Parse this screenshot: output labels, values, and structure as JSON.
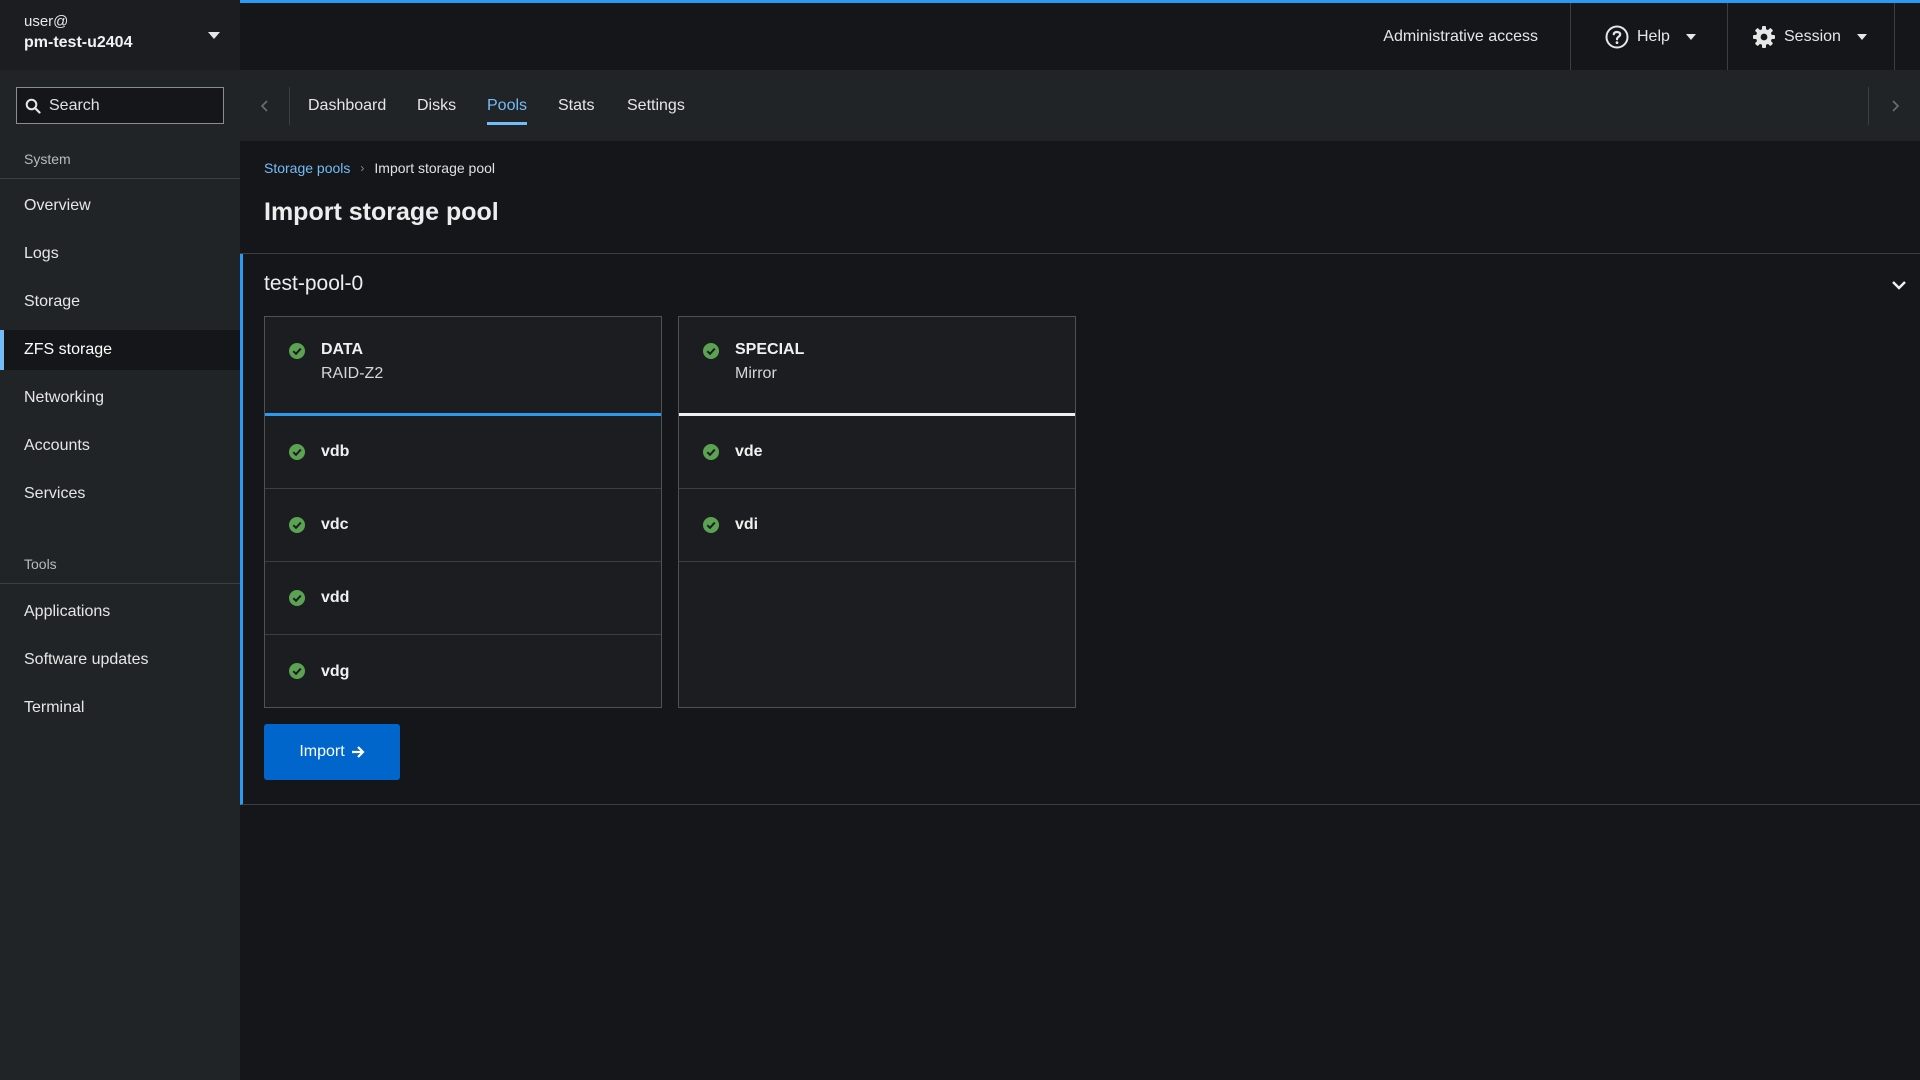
{
  "sidebar": {
    "host_user": "user@",
    "host_name": "pm-test-u2404",
    "search_placeholder": "Search",
    "section_system": "System",
    "system_items": [
      {
        "label": "Overview"
      },
      {
        "label": "Logs"
      },
      {
        "label": "Storage"
      },
      {
        "label": "ZFS storage",
        "active": true
      },
      {
        "label": "Networking"
      },
      {
        "label": "Accounts"
      },
      {
        "label": "Services"
      }
    ],
    "section_tools": "Tools",
    "tools_items": [
      {
        "label": "Applications"
      },
      {
        "label": "Software updates"
      },
      {
        "label": "Terminal"
      }
    ]
  },
  "header": {
    "admin_access": "Administrative access",
    "help_label": "Help",
    "session_label": "Session"
  },
  "tabs": [
    {
      "label": "Dashboard"
    },
    {
      "label": "Disks"
    },
    {
      "label": "Pools",
      "active": true
    },
    {
      "label": "Stats"
    },
    {
      "label": "Settings"
    }
  ],
  "breadcrumb": {
    "parent": "Storage pools",
    "current": "Import storage pool"
  },
  "page_title": "Import storage pool",
  "pool": {
    "name": "test-pool-0",
    "vdevs": [
      {
        "type": "DATA",
        "layout": "RAID-Z2",
        "disks": [
          "vdb",
          "vdc",
          "vdd",
          "vdg"
        ]
      },
      {
        "type": "SPECIAL",
        "layout": "Mirror",
        "disks": [
          "vde",
          "vdi"
        ]
      }
    ],
    "import_label": "Import"
  },
  "colors": {
    "accent": "#2b9af3",
    "link": "#73bcf7",
    "primary_button": "#0066cc",
    "status_ok": "#3e8635",
    "background": "#151619",
    "sidebar": "#212427"
  },
  "icons": [
    "search-icon",
    "help-circle-icon",
    "gear-icon",
    "caret-down-icon",
    "chevron-left-icon",
    "chevron-right-icon",
    "chevron-down-icon",
    "check-circle-icon",
    "arrow-right-icon"
  ]
}
